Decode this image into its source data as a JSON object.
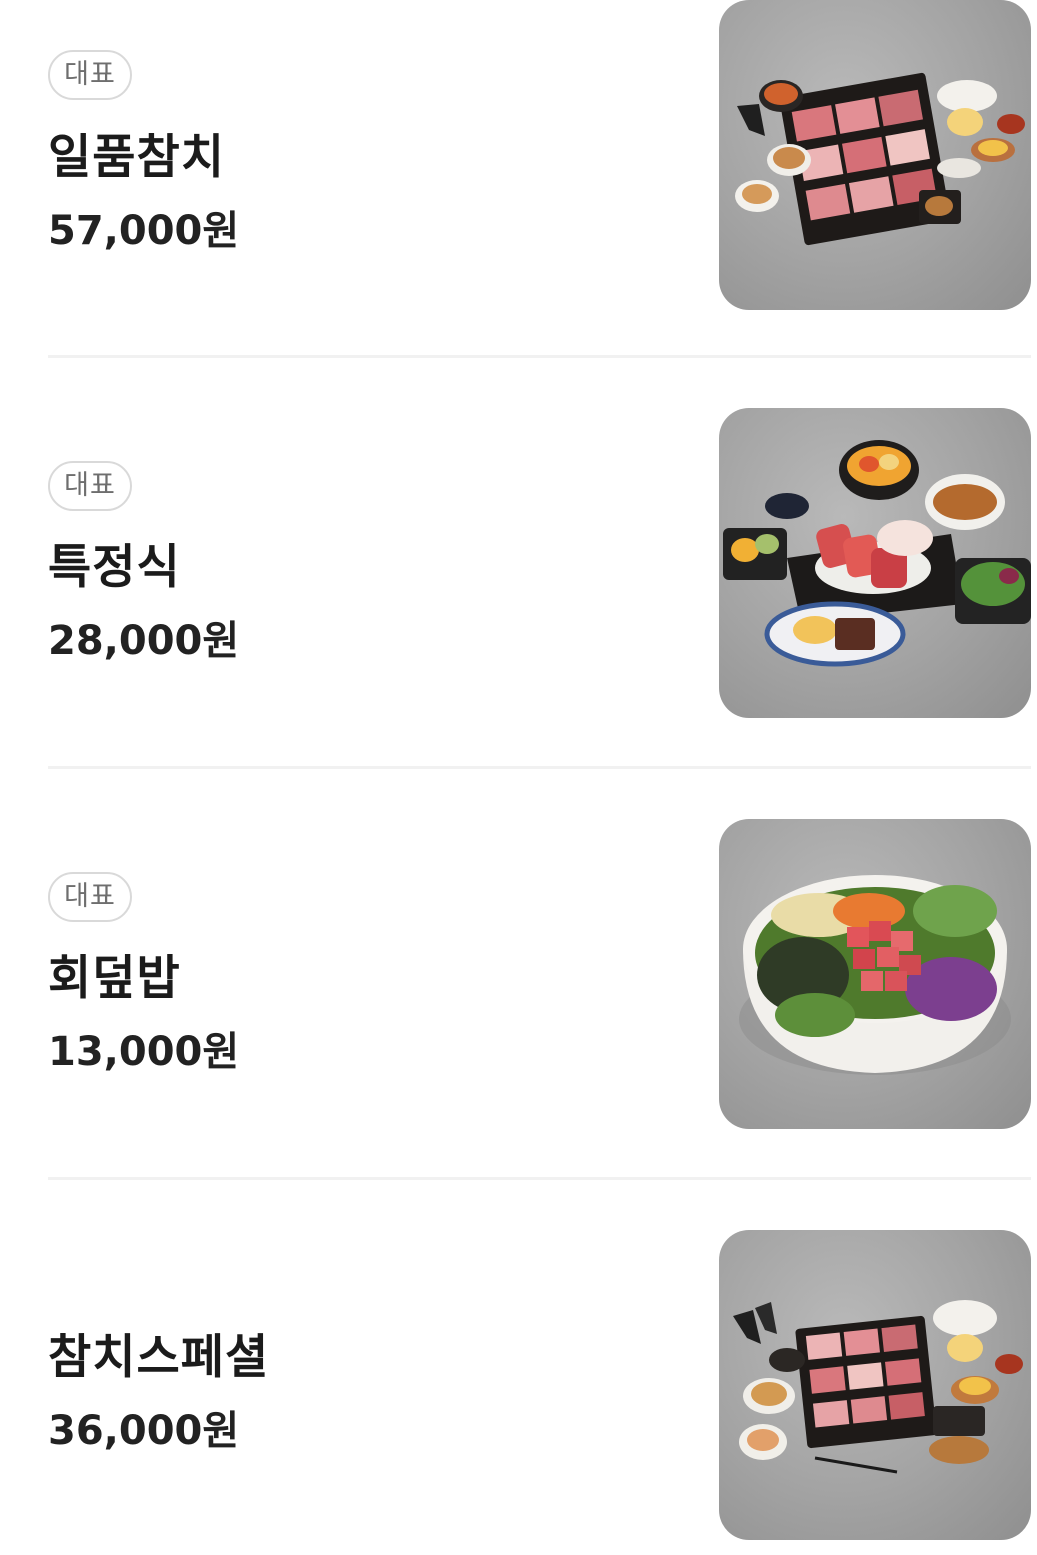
{
  "menu": {
    "items": [
      {
        "badge": "대표",
        "name": "일품참치",
        "price": "57,000원",
        "photo": "tuna-course-set-photo"
      },
      {
        "badge": "대표",
        "name": "특정식",
        "price": "28,000원",
        "photo": "special-set-meal-photo"
      },
      {
        "badge": "대표",
        "name": "회덮밥",
        "price": "13,000원",
        "photo": "raw-fish-bibimbap-bowl-photo"
      },
      {
        "badge": "",
        "name": "참치스페셜",
        "price": "36,000원",
        "photo": "tuna-special-set-photo"
      }
    ]
  },
  "colors": {
    "text": "#1b1b1b",
    "badge_border": "#d9d9d9",
    "badge_text": "#6e6e6e",
    "divider": "#f1f1f1",
    "photo_background": "#a8a8a8"
  }
}
